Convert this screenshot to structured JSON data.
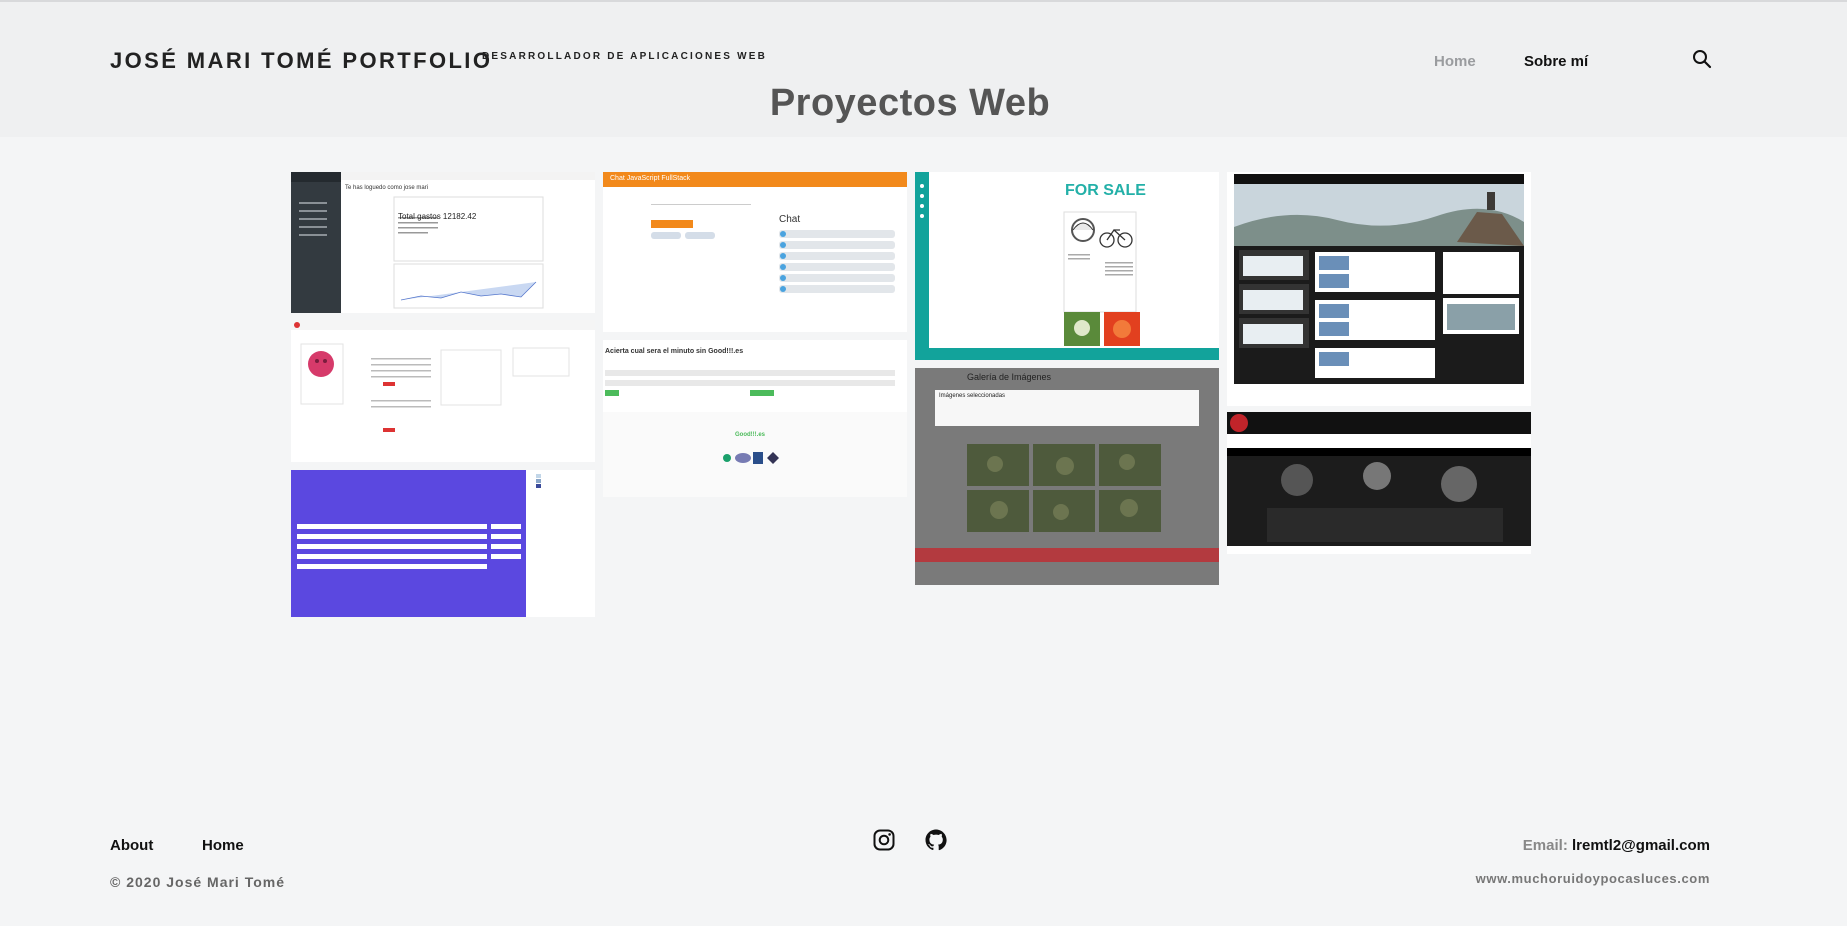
{
  "header": {
    "brand": "JOSÉ MARI TOMÉ PORTFOLIO",
    "tagline": "DESARROLLADOR DE APLICACIONES WEB",
    "nav": {
      "home": "Home",
      "about": "Sobre mí"
    },
    "search_icon": "search-icon"
  },
  "page": {
    "title": "Proyectos Web"
  },
  "projects": {
    "expenses": {
      "logged": "Te has loguedo como jose mari",
      "total": "Total gastos 12182.42"
    },
    "chat": {
      "bar": "Chat JavaScript FullStack",
      "heading": "Chat"
    },
    "forsale": {
      "logo": "FOR SALE"
    },
    "good": {
      "heading": "Acierta cual sera el minuto sin Good!!!.es",
      "footer_logo": "Good!!!.es"
    },
    "gallery": {
      "heading": "Galería de Imágenes",
      "selected": "Imágenes seleccionadas"
    }
  },
  "footer": {
    "about": "About",
    "home": "Home",
    "copyright": "© 2020 José Mari Tomé",
    "email_label": "Email:",
    "email": "lremtl2@gmail.com",
    "website": "www.muchoruidoypocasluces.com",
    "social_icons": [
      "instagram-icon",
      "github-icon"
    ]
  },
  "colors": {
    "accent_orange": "#f2891b",
    "purple": "#5b48e0",
    "teal": "#12a39b"
  }
}
